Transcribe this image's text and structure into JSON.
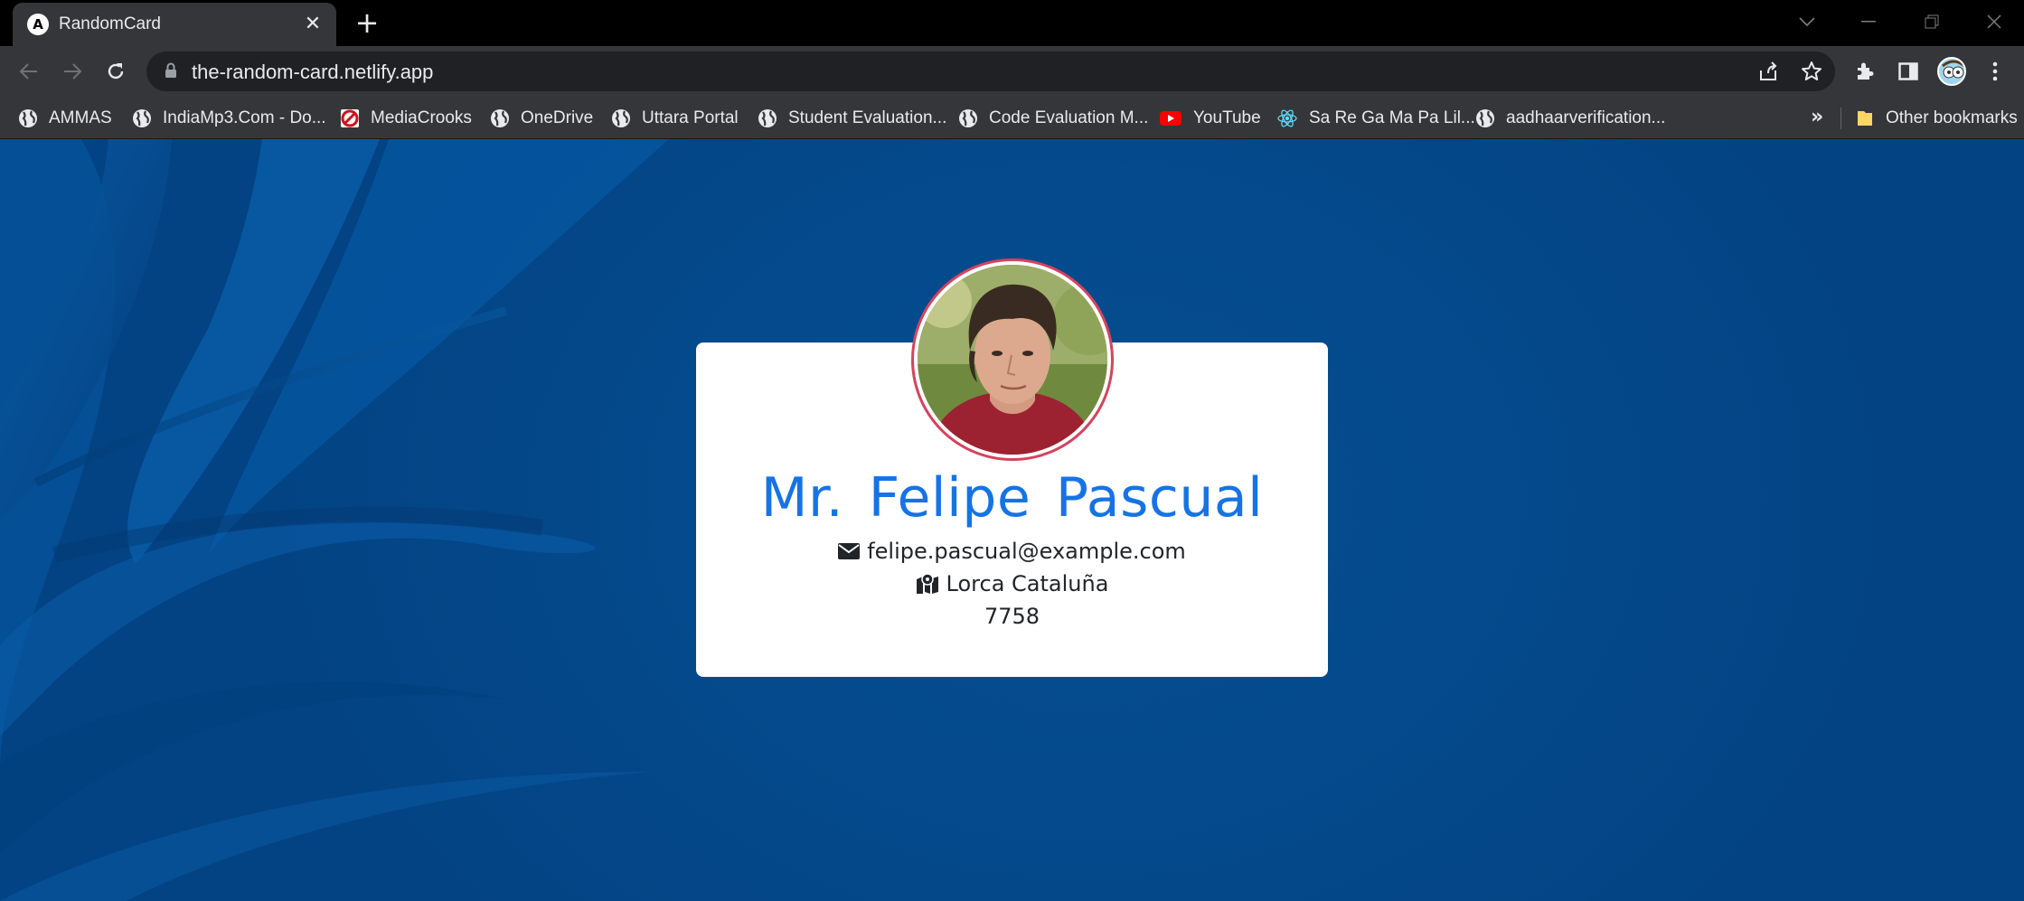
{
  "browser": {
    "tab_title": "RandomCard",
    "tab_favicon_letter": "A",
    "url": "the-random-card.netlify.app",
    "bookmarks": [
      {
        "label": "AMMAS",
        "icon": "globe-icon"
      },
      {
        "label": "IndiaMp3.Com - Do...",
        "icon": "globe-icon"
      },
      {
        "label": "MediaCrooks",
        "icon": "mediacrooks-icon"
      },
      {
        "label": "OneDrive",
        "icon": "globe-icon"
      },
      {
        "label": "Uttara Portal",
        "icon": "globe-icon"
      },
      {
        "label": "Student Evaluation...",
        "icon": "globe-icon"
      },
      {
        "label": "Code Evaluation M...",
        "icon": "globe-icon"
      },
      {
        "label": "YouTube",
        "icon": "youtube-icon"
      },
      {
        "label": "Sa Re Ga Ma Pa Lil...",
        "icon": "react-icon"
      },
      {
        "label": "aadhaarverification...",
        "icon": "globe-icon"
      }
    ],
    "bookmarks_overflow": "»",
    "other_bookmarks": "Other bookmarks"
  },
  "card": {
    "name": "Mr. Felipe Pascual",
    "email": "felipe.pascual@example.com",
    "location": "Lorca Cataluña",
    "postcode": "7758"
  },
  "colors": {
    "page_bg": "#044a8c",
    "name_color": "#1673e6",
    "avatar_border": "#d6435d"
  }
}
